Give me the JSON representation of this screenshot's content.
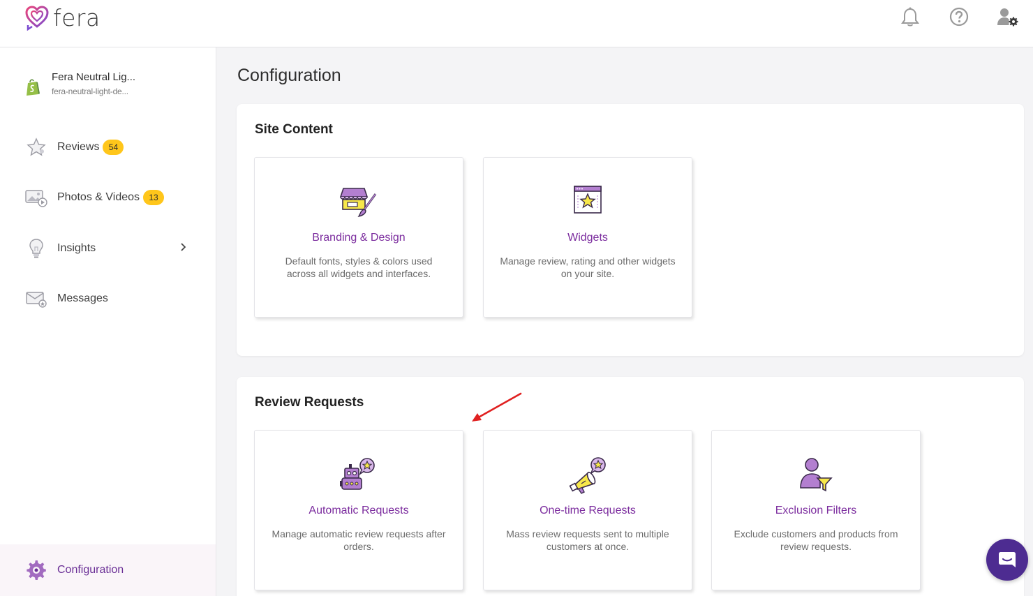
{
  "header": {
    "logo_text": "fera",
    "icons": [
      "bell-icon",
      "help-icon",
      "user-settings-icon"
    ]
  },
  "sidebar": {
    "store": {
      "name": "Fera Neutral Lig...",
      "subdomain": "fera-neutral-light-de..."
    },
    "items": [
      {
        "label": "Reviews",
        "badge": "54",
        "icon": "star-icon"
      },
      {
        "label": "Photos & Videos",
        "badge": "13",
        "icon": "media-icon"
      },
      {
        "label": "Insights",
        "icon": "lightbulb-icon",
        "has_submenu": true
      },
      {
        "label": "Messages",
        "icon": "mail-icon"
      }
    ],
    "active": {
      "label": "Configuration",
      "icon": "gear-icon"
    }
  },
  "main": {
    "title": "Configuration",
    "sections": [
      {
        "title": "Site Content",
        "cards": [
          {
            "title": "Branding & Design",
            "description": "Default fonts, styles & colors used across all widgets and interfaces.",
            "icon": "storefront-brush-icon"
          },
          {
            "title": "Widgets",
            "description": "Manage review, rating and other widgets on your site.",
            "icon": "widget-star-icon"
          }
        ]
      },
      {
        "title": "Review Requests",
        "cards": [
          {
            "title": "Automatic Requests",
            "description": "Manage automatic review requests after orders.",
            "icon": "robot-icon"
          },
          {
            "title": "One-time Requests",
            "description": "Mass review requests sent to multiple customers at once.",
            "icon": "megaphone-icon"
          },
          {
            "title": "Exclusion Filters",
            "description": "Exclude customers and products from review requests.",
            "icon": "user-filter-icon"
          }
        ]
      }
    ]
  },
  "colors": {
    "accent": "#7b2c9e",
    "badge": "#ffc61b",
    "chat": "#4d2c91",
    "annotation_arrow": "#e02020"
  }
}
